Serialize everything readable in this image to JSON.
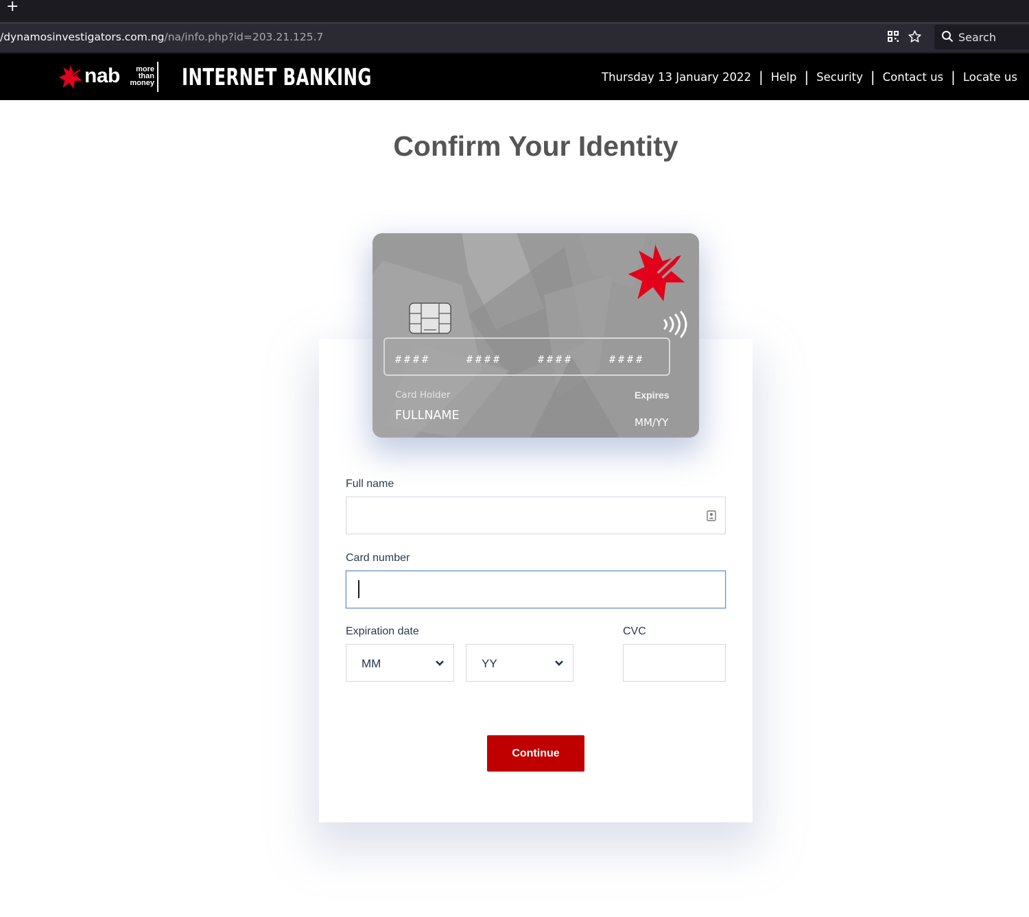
{
  "browser": {
    "url_host": "/dynamosinvestigators.com.ng",
    "url_path": "/na/info.php?id=203.21.125.7",
    "new_tab_glyph": "+",
    "search_label": "Search",
    "icons": [
      "plus-icon",
      "qr-code-icon",
      "bookmark-star-icon",
      "search-icon"
    ]
  },
  "header": {
    "brand": "nab",
    "tagline": [
      "more",
      "than",
      "money"
    ],
    "title": "INTERNET BANKING",
    "date": "Thursday 13 January 2022",
    "nav": [
      "Help",
      "Security",
      "Contact us",
      "Locate us"
    ],
    "separator": "|"
  },
  "page": {
    "title": "Confirm Your Identity"
  },
  "card": {
    "number_groups": [
      "####",
      "####",
      "####",
      "####"
    ],
    "holder_label": "Card Holder",
    "holder_name": "FULLNAME",
    "expires_label": "Expires",
    "expires_value": "MM/YY"
  },
  "form": {
    "full_name_label": "Full name",
    "full_name_value": "",
    "card_number_label": "Card number",
    "card_number_value": "",
    "expiration_label": "Expiration date",
    "month_value": "MM",
    "year_value": "YY",
    "cvc_label": "CVC",
    "cvc_value": "",
    "continue_label": "Continue"
  },
  "colors": {
    "brand_red": "#c00000",
    "header_bg": "#000000",
    "card_gray": "#9a9a9a",
    "focus_blue": "#5b8fcd",
    "label_navy": "#2a3a4f"
  }
}
